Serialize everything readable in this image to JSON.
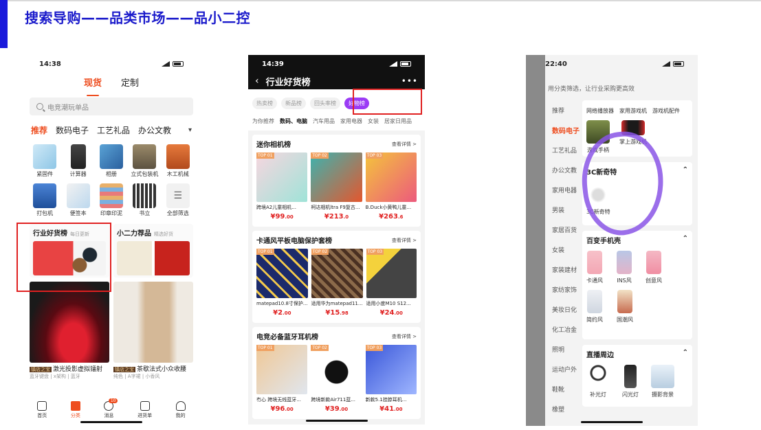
{
  "slide": {
    "title": "搜索导购——品类市场——品小二控"
  },
  "phone1": {
    "time": "14:38",
    "segments": [
      "现货",
      "定制"
    ],
    "search_placeholder": "电竞潮玩单品",
    "cat_tabs": [
      "推荐",
      "数码电子",
      "工艺礼品",
      "办公文教"
    ],
    "grid": [
      "紧固件",
      "计算器",
      "相册",
      "立式包装机",
      "木工机械",
      "打包机",
      "便签本",
      "印章印泥",
      "书立",
      "全部筛选"
    ],
    "card1": {
      "title": "行业好货榜",
      "sub": "每日更新"
    },
    "card2": {
      "title": "小二力荐品",
      "sub": "精选好货"
    },
    "prod1": {
      "tag": "镇店之宝",
      "title": "激光投影虚拟镭射",
      "meta": "蓝牙键盘 | x架构 | 蓝牙"
    },
    "prod2": {
      "tag": "镇店之宝",
      "title": "茶歇法式小众收腰",
      "meta": "纯色 | A字裙 | 小香风"
    },
    "tabbar": [
      "首页",
      "分类",
      "消息",
      "进货单",
      "我的"
    ],
    "msg_badge": "10"
  },
  "phone2": {
    "time": "14:39",
    "title": "行业好货榜",
    "chips": [
      "热卖榜",
      "新品榜",
      "回头率榜",
      "好物榜"
    ],
    "subtabs": [
      "为你推荐",
      "数码、电脑",
      "汽车用品",
      "家用电器",
      "女装",
      "居家日用品"
    ],
    "more": "查看详情 >",
    "ranks": [
      {
        "title": "迷你相机榜",
        "items": [
          {
            "top": "TOP 01",
            "t": "跨境A2儿童相机...",
            "p": "¥99",
            "d": ".00"
          },
          {
            "top": "TOP 02",
            "t": "柯达相机ltra F9复古...",
            "p": "¥213",
            "d": ".0"
          },
          {
            "top": "TOP 03",
            "t": "B.Duck小黄鸭儿童...",
            "p": "¥263",
            "d": ".6"
          }
        ]
      },
      {
        "title": "卡通风平板电脑保护套榜",
        "items": [
          {
            "top": "TOP 01",
            "t": "matepad10.8寸保护...",
            "p": "¥2",
            "d": ".00"
          },
          {
            "top": "TOP 02",
            "t": "适用华为matepad11...",
            "p": "¥15",
            "d": ".98"
          },
          {
            "top": "TOP 03",
            "t": "适用小度M10 S12...",
            "p": "¥24",
            "d": ".00"
          }
        ]
      },
      {
        "title": "电竞必备蓝牙耳机榜",
        "items": [
          {
            "top": "TOP 01",
            "t": "冇心 跨境无线蓝牙...",
            "p": "¥96",
            "d": ".00"
          },
          {
            "top": "TOP 02",
            "t": "跨境新款Air711蓝...",
            "p": "¥39",
            "d": ".00"
          },
          {
            "top": "TOP 03",
            "t": "新款5.1挂脖耳机...",
            "p": "¥41",
            "d": ".00"
          }
        ]
      }
    ]
  },
  "phone3": {
    "time": "22:40",
    "hint": "用分类筛选，让行业采购更高效",
    "side": [
      "推荐",
      "数码电子",
      "工艺礼品",
      "办公文教",
      "家用电器",
      "男装",
      "家居百货",
      "女装",
      "家装建材",
      "家纺家饰",
      "美妆日化",
      "化工冶金",
      "照明",
      "运动户外",
      "鞋靴",
      "橡塑",
      "箱包"
    ],
    "top_labels": [
      "网络播放器",
      "家用游戏机",
      "游戏机配件"
    ],
    "top_items": [
      "游戏手柄",
      "掌上游戏机"
    ],
    "box1": {
      "title": "3C新奇特",
      "items": [
        "3C新奇特"
      ]
    },
    "box2": {
      "title": "百变手机壳",
      "items": [
        "卡通风",
        "INS风",
        "创意风",
        "简约风",
        "国潮风"
      ]
    },
    "box3": {
      "title": "直播周边",
      "items": [
        "补光灯",
        "闪光灯",
        "摄影背景"
      ]
    },
    "bg_partial": [
      "推荐",
      "手机",
      "移动",
      "上新",
      "¥29",
      "深圳"
    ]
  },
  "colors": {
    "title": "#1a1acb",
    "accent": "#ee4d1f",
    "price": "#e02020",
    "chip": "#9b3cf5",
    "annotation": "#8a55e6"
  }
}
